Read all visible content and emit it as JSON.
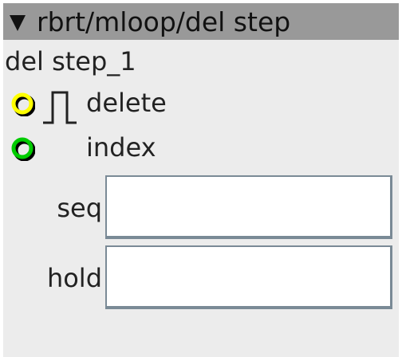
{
  "window": {
    "title": "rbrt/mloop/del step"
  },
  "object": {
    "name": "del step_1"
  },
  "ports": [
    {
      "label": "delete",
      "color": "#ffff00",
      "icon": "pulse-icon"
    },
    {
      "label": "index",
      "color": "#00cc00",
      "icon": ""
    }
  ],
  "fields": [
    {
      "label": "seq",
      "value": ""
    },
    {
      "label": "hold",
      "value": ""
    }
  ],
  "colors": {
    "titlebar": "#999999",
    "panel": "#ececec",
    "field_border": "#7a8a96"
  }
}
